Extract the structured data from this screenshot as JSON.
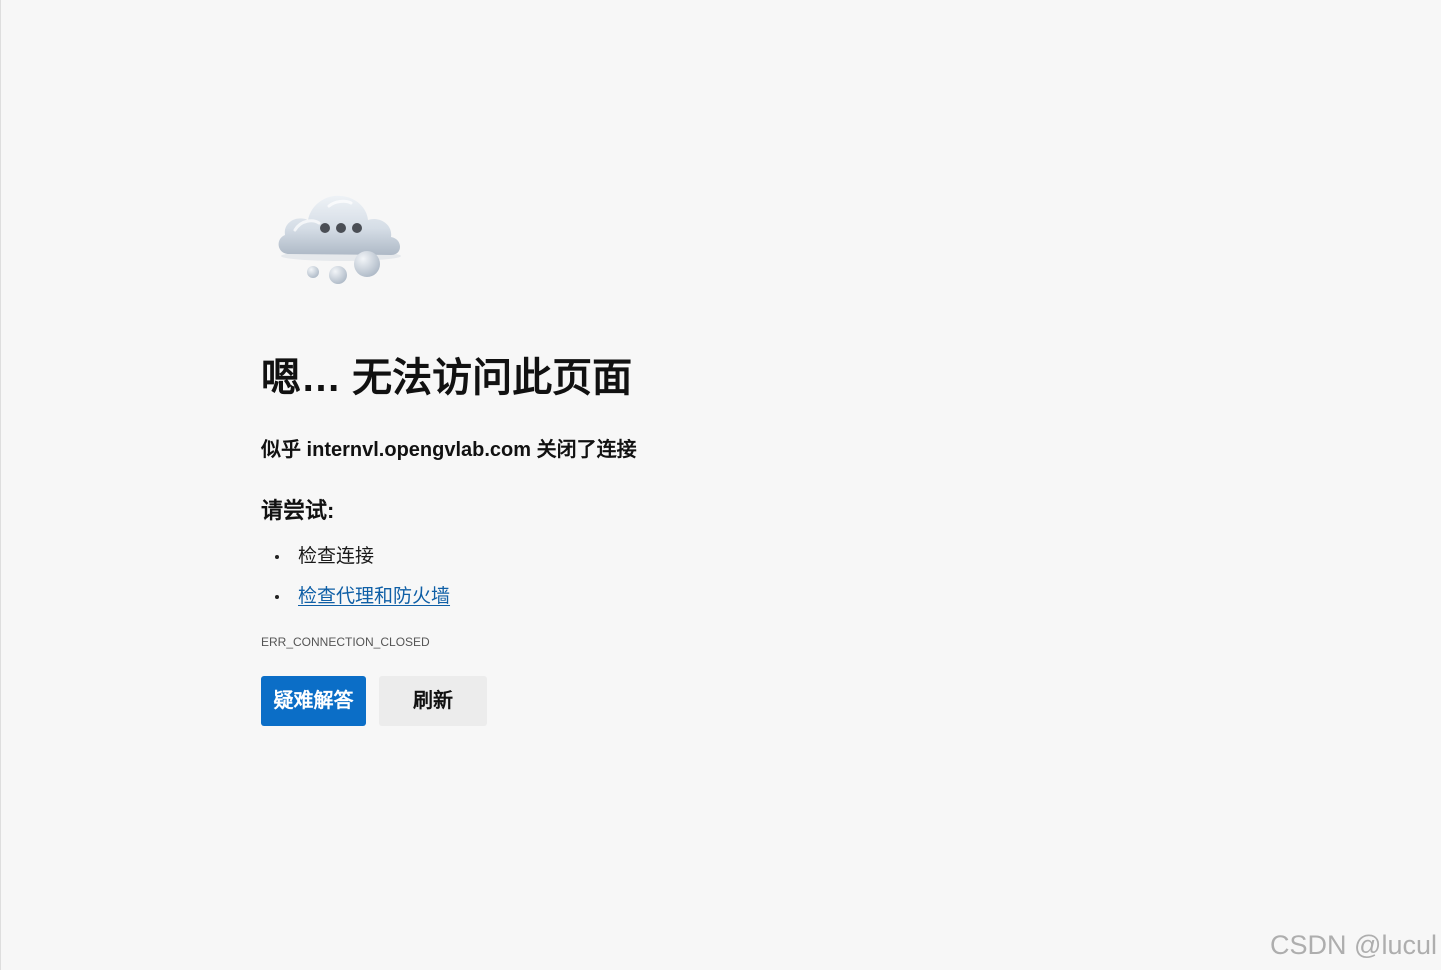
{
  "page": {
    "title": "嗯… 无法访问此页面",
    "subtitle": "似乎 internvl.opengvlab.com 关闭了连接"
  },
  "suggestions": {
    "heading": "请尝试:",
    "items": [
      {
        "label": "检查连接",
        "is_link": false
      },
      {
        "label": "检查代理和防火墙",
        "is_link": true
      }
    ]
  },
  "error": {
    "code": "ERR_CONNECTION_CLOSED"
  },
  "actions": {
    "troubleshoot_label": "疑难解答",
    "refresh_label": "刷新"
  },
  "watermark": {
    "text": "CSDN @lucul"
  },
  "icons": {
    "illustration": "cloud-thinking-icon"
  },
  "colors": {
    "background": "#f7f7f7",
    "primary_button": "#0b6ec7",
    "secondary_button": "#ececec",
    "link": "#0f5fa6",
    "text": "#111111"
  }
}
